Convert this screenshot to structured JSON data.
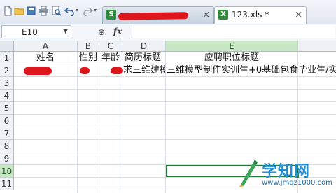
{
  "tabs": [
    {
      "label": "",
      "redacted": true
    },
    {
      "label": "123.xls *",
      "close": "×"
    }
  ],
  "toolbar": {
    "icons": [
      "doc-icon",
      "folder-icon",
      "save-icon",
      "print-icon",
      "print-preview-icon",
      "undo-icon",
      "undo-dropdown-icon",
      "redo-icon",
      "redo-dropdown-icon"
    ]
  },
  "formula_bar": {
    "cell_ref": "E10",
    "zoom_symbol": "⊕",
    "fx_label": "fx",
    "value": ""
  },
  "sheet": {
    "columns": [
      "A",
      "B",
      "C",
      "D",
      "E"
    ],
    "rows": [
      "1",
      "2",
      "3",
      "4",
      "5",
      "6",
      "7",
      "8",
      "9",
      "10",
      "11"
    ],
    "active_cell": "E10",
    "row1": {
      "A": "姓名",
      "B": "性别",
      "C": "年龄",
      "D": "简历标题",
      "E": "应聘职位标题"
    },
    "row2": {
      "D": "求三维建模",
      "E": "三维模型制作实训生+0基础包食毕业生/实"
    }
  },
  "watermark": {
    "title": "学知网",
    "url": "www.jmqz1000.com"
  },
  "colors": {
    "selection": "#1f7a36",
    "header_active": "#c9e6c7",
    "redaction": "#e0161d"
  }
}
